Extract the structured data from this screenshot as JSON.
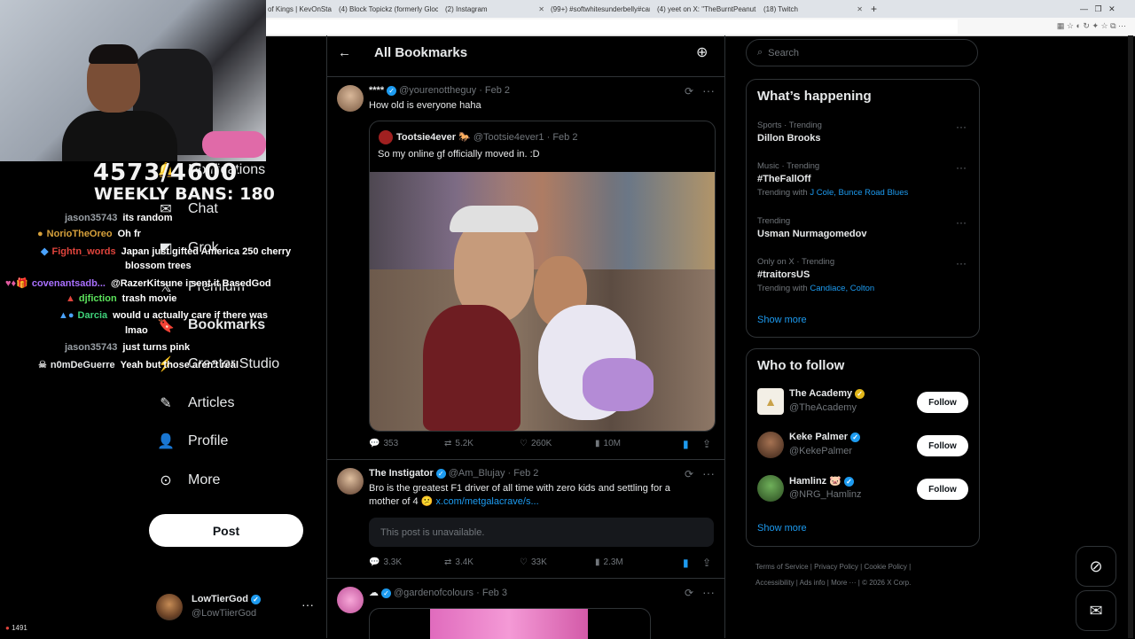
{
  "browser": {
    "tabs": [
      {
        "label": "of Kings | KevOnStage",
        "left": 0
      },
      {
        "label": "(4) Block Topickz (formerly Glock...",
        "left": 0
      },
      {
        "label": "(2) Instagram",
        "left": 0
      },
      {
        "label": "(99+) #softwhitesunderbelly#carte...",
        "left": 0
      },
      {
        "label": "(4) yeet on X: \"TheBurntPeanut no...",
        "left": 0
      },
      {
        "label": "(18) Twitch",
        "left": 0
      }
    ]
  },
  "overlay": {
    "count": "4573/4600",
    "bans": "WEEKLY BANS: 180",
    "viewers": "1491",
    "chat": [
      {
        "name": "jason35743",
        "color": "#9aa0a6",
        "msg": "its random"
      },
      {
        "name": "NorioTheOreo",
        "color": "#d7a13b",
        "msg": "Oh fr"
      },
      {
        "name": "Fightn_words",
        "color": "#e0443c",
        "msg": "Japan just gifted America 250 cherry"
      },
      {
        "name": "",
        "color": "#fff",
        "msg": "blossom trees"
      },
      {
        "name": "covenantsadb...",
        "color": "#a970ff",
        "msg": "@RazerKitsune i sent it BasedGod"
      },
      {
        "name": "djfiction",
        "color": "#5ce35c",
        "msg": "trash movie"
      },
      {
        "name": "Darcia",
        "color": "#3fd17a",
        "msg": "would u actually care if there was"
      },
      {
        "name": "",
        "color": "#fff",
        "msg": "lmao"
      },
      {
        "name": "jason35743",
        "color": "#9aa0a6",
        "msg": "just turns pink"
      },
      {
        "name": "n0mDeGuerre",
        "color": "#e7e9ea",
        "msg": "Yeah but those aren't real"
      }
    ]
  },
  "nav": {
    "items": [
      {
        "label": "Notifications",
        "icon": "bell-icon"
      },
      {
        "label": "Chat",
        "icon": "mail-icon"
      },
      {
        "label": "Grok",
        "icon": "grok-icon"
      },
      {
        "label": "Premium",
        "icon": "x-logo-icon"
      },
      {
        "label": "Bookmarks",
        "icon": "bookmark-icon"
      },
      {
        "label": "Creator Studio",
        "icon": "creator-icon"
      },
      {
        "label": "Articles",
        "icon": "article-icon"
      },
      {
        "label": "Profile",
        "icon": "person-icon"
      },
      {
        "label": "More",
        "icon": "more-circle-icon"
      }
    ],
    "post_label": "Post",
    "me": {
      "name": "LowTierGod",
      "handle": "@LowTiierGod"
    }
  },
  "main": {
    "title": "All Bookmarks",
    "tweets": [
      {
        "name": "****",
        "handle": "@yourenottheguy",
        "date": "· Feb 2",
        "text": "How old is everyone haha",
        "quote": {
          "name": "Tootsie4ever",
          "handle": "@Tootsie4ever1",
          "date": "· Feb 2",
          "text": "So my online gf officially  moved in. :D"
        },
        "replies": "353",
        "retweets": "5.2K",
        "likes": "260K",
        "views": "10M"
      },
      {
        "name": "The Instigator",
        "handle": "@Am_Blujay",
        "date": "· Feb 2",
        "text": "Bro is the greatest F1 driver of all time with zero kids and settling for a mother of 4",
        "link": "x.com/metgalacrave/s...",
        "unavailable": "This post is unavailable.",
        "replies": "3.3K",
        "retweets": "3.4K",
        "likes": "33K",
        "views": "2.3M"
      },
      {
        "name": "",
        "handle": "@gardenofcolours",
        "date": "· Feb 3"
      }
    ]
  },
  "sidebar": {
    "search_placeholder": "Search",
    "happening_title": "What’s happening",
    "trends": [
      {
        "meta": "Sports · Trending",
        "topic": "Dillon Brooks",
        "extra_label": "",
        "extra": ""
      },
      {
        "meta": "Music · Trending",
        "topic": "#TheFallOff",
        "extra_label": "Trending with",
        "extra": "J Cole, Bunce Road Blues"
      },
      {
        "meta": "Trending",
        "topic": "Usman Nurmagomedov",
        "extra_label": "",
        "extra": ""
      },
      {
        "meta": "Only on X · Trending",
        "topic": "#traitorsUS",
        "extra_label": "Trending with",
        "extra": "Candiace, Colton"
      }
    ],
    "show_more": "Show more",
    "who_title": "Who to follow",
    "follow": [
      {
        "name": "The Academy",
        "handle": "@TheAcademy",
        "badge": "gold"
      },
      {
        "name": "Keke Palmer",
        "handle": "@KekePalmer",
        "badge": "blue"
      },
      {
        "name": "Hamlinz",
        "handle": "@NRG_Hamlinz",
        "badge": "blue"
      }
    ],
    "follow_label": "Follow",
    "footer": {
      "terms": "Terms of Service",
      "privacy": "Privacy Policy",
      "cookie": "Cookie Policy",
      "access": "Accessibility",
      "ads": "Ads info",
      "more": "More ···",
      "corp": "© 2026 X Corp."
    }
  },
  "colors": {
    "accent": "#1d9bf0",
    "background": "#000000",
    "border": "#2f3336"
  }
}
